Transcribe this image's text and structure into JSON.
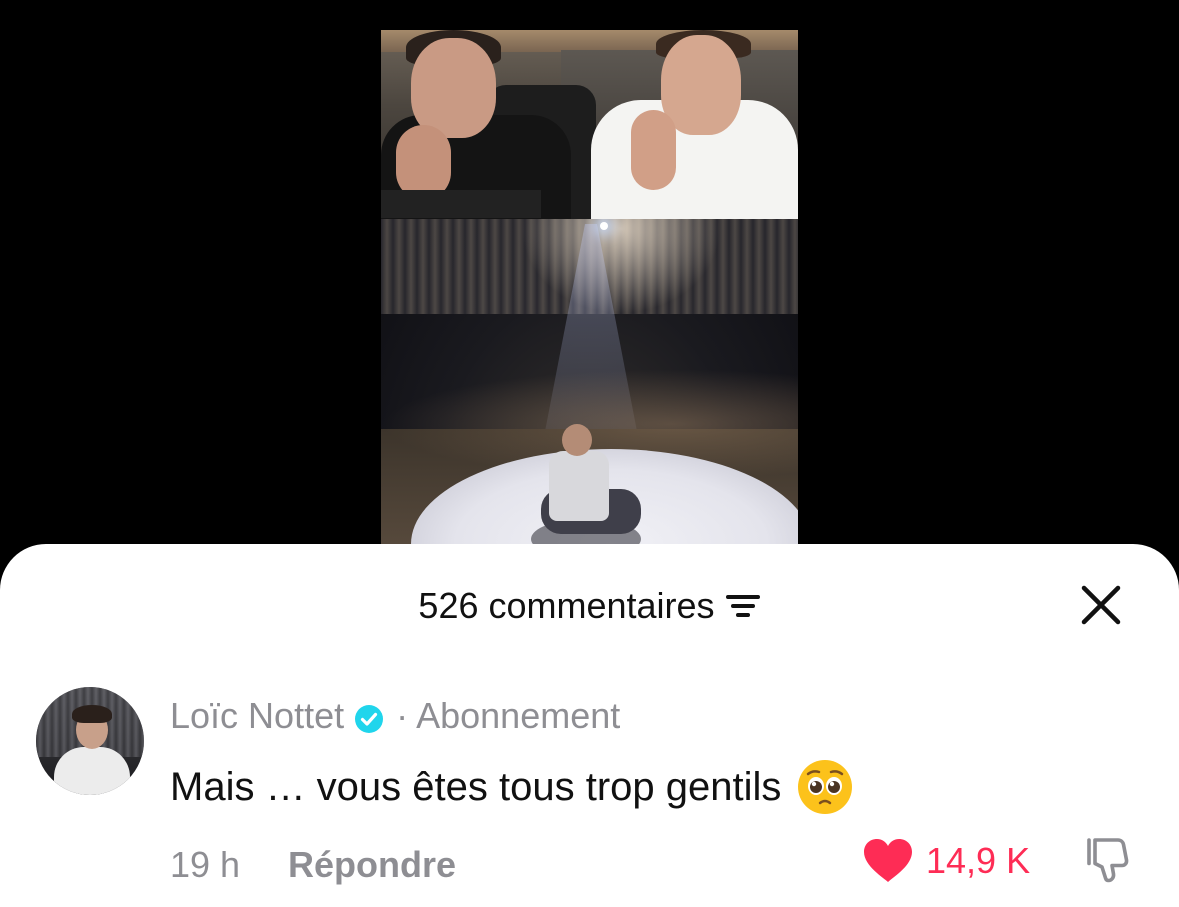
{
  "colors": {
    "background": "#000000",
    "sheet": "#ffffff",
    "text_primary": "#111111",
    "text_secondary": "#8e8e93",
    "like_accent": "#fe2c55",
    "verified_badge": "#20d5ec"
  },
  "comments_sheet": {
    "title": "526 commentaires",
    "filter_icon": "filter-lines-icon",
    "close_icon": "close-icon"
  },
  "comment": {
    "author": "Loïc Nottet",
    "verified_icon": "verified-badge-icon",
    "separator": "·",
    "follow_status": "Abonnement",
    "text": "Mais … vous êtes tous trop gentils",
    "emoji": "pleading-face-emoji",
    "time": "19 h",
    "reply_label": "Répondre",
    "likes": "14,9 K",
    "liked": true,
    "like_icon": "heart-icon",
    "dislike_icon": "thumbs-down-icon"
  }
}
